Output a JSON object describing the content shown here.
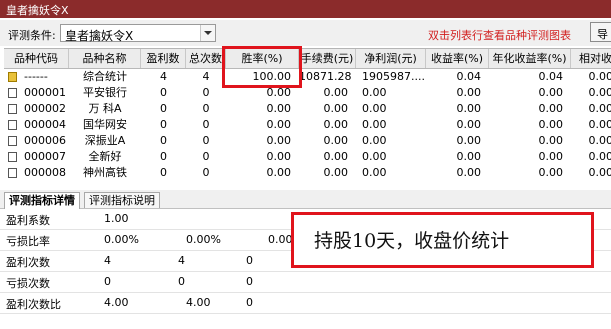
{
  "window": {
    "title": "皇者擒妖令X"
  },
  "filter": {
    "label": "评测条件:",
    "selected": "皇者擒妖令X",
    "hint": "双击列表行查看品种评测图表",
    "export_label": "导"
  },
  "table": {
    "columns": [
      "品种代码",
      "品种名称",
      "盈利数",
      "总次数",
      "胜率(%)",
      "手续费(元)",
      "净利润(元)",
      "收益率(%)",
      "年化收益率(%)",
      "相对收"
    ],
    "rows": [
      {
        "code": "------",
        "name": "综合统计",
        "win": "4",
        "total": "4",
        "rate": "100.00",
        "fee": "10871.28",
        "profit": "1905987....",
        "ret": "0.04",
        "annual": "0.04",
        "rel": "0.00",
        "icon": "folder-icon"
      },
      {
        "code": "000001",
        "name": "平安银行",
        "win": "0",
        "total": "0",
        "rate": "0.00",
        "fee": "0.00",
        "profit": "0.00",
        "ret": "0.00",
        "annual": "0.00",
        "rel": "0.00",
        "icon": "checkbox-icon"
      },
      {
        "code": "000002",
        "name": "万 科A",
        "win": "0",
        "total": "0",
        "rate": "0.00",
        "fee": "0.00",
        "profit": "0.00",
        "ret": "0.00",
        "annual": "0.00",
        "rel": "0.00",
        "icon": "checkbox-icon"
      },
      {
        "code": "000004",
        "name": "国华网安",
        "win": "0",
        "total": "0",
        "rate": "0.00",
        "fee": "0.00",
        "profit": "0.00",
        "ret": "0.00",
        "annual": "0.00",
        "rel": "0.00",
        "icon": "checkbox-icon"
      },
      {
        "code": "000006",
        "name": "深振业A",
        "win": "0",
        "total": "0",
        "rate": "0.00",
        "fee": "0.00",
        "profit": "0.00",
        "ret": "0.00",
        "annual": "0.00",
        "rel": "0.00",
        "icon": "checkbox-icon"
      },
      {
        "code": "000007",
        "name": "全新好",
        "win": "0",
        "total": "0",
        "rate": "0.00",
        "fee": "0.00",
        "profit": "0.00",
        "ret": "0.00",
        "annual": "0.00",
        "rel": "0.00",
        "icon": "checkbox-icon"
      },
      {
        "code": "000008",
        "name": "神州高铁",
        "win": "0",
        "total": "0",
        "rate": "0.00",
        "fee": "0.00",
        "profit": "0.00",
        "ret": "0.00",
        "annual": "0.00",
        "rel": "0.00",
        "icon": "checkbox-icon"
      }
    ]
  },
  "tabs": [
    "评测指标详情",
    "评测指标说明"
  ],
  "details": [
    {
      "name": "盈利系数",
      "values": [
        "1.00"
      ]
    },
    {
      "name": "亏损比率",
      "values": [
        "0.00%",
        "0.00%",
        "0.00%"
      ]
    },
    {
      "name": "盈利次数",
      "values": [
        "4",
        "4",
        "0"
      ]
    },
    {
      "name": "亏损次数",
      "values": [
        "0",
        "0",
        "0"
      ]
    },
    {
      "name": "盈利次数比",
      "values": [
        "4.00",
        "4.00",
        "0"
      ]
    }
  ],
  "annotation": "持股10天，收盘价统计",
  "colors": {
    "titlebar": "#8b2b2b",
    "hint": "#d21f1f",
    "highlight_border": "#e0141c"
  }
}
